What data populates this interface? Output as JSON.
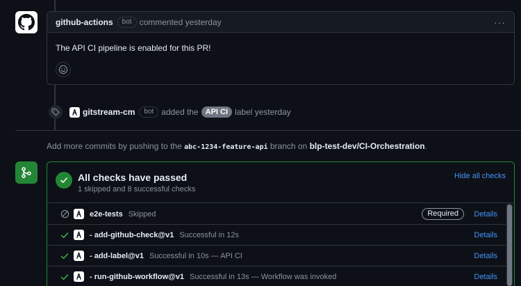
{
  "comment": {
    "author": "github-actions",
    "bot_label": "bot",
    "action": "commented yesterday",
    "more_icon": "kebab-horizontal-icon",
    "body": "The API CI pipeline is enabled for this PR!",
    "reaction_icon": "smiley-icon"
  },
  "label_event": {
    "icon": "tag-icon",
    "actor": "gitstream-cm",
    "bot_label": "bot",
    "verb": "added the",
    "label": "API CI",
    "suffix": "label yesterday",
    "label_color": "#6e7681"
  },
  "push_hint": {
    "prefix": "Add more commits by pushing to the",
    "branch": "abc-1234-feature-api",
    "middle": "branch on",
    "repo": "blp-test-dev/CI-Orchestration",
    "suffix": "."
  },
  "checks": {
    "icon": "git-merge-icon",
    "title": "All checks have passed",
    "subtitle": "1 skipped and 8 successful checks",
    "hide_label": "Hide all checks",
    "accent": "#238636",
    "rows": [
      {
        "status": "skipped",
        "name": "e2e-tests",
        "detail": "Skipped",
        "required": "Required",
        "details": "Details"
      },
      {
        "status": "success",
        "name": "- add-github-check@v1",
        "detail": "Successful in 12s",
        "details": "Details"
      },
      {
        "status": "success",
        "name": "- add-label@v1",
        "detail": "Successful in 10s — API CI",
        "details": "Details"
      },
      {
        "status": "success",
        "name": "- run-github-workflow@v1",
        "detail": "Successful in 13s — Workflow was invoked",
        "details": "Details"
      }
    ]
  }
}
